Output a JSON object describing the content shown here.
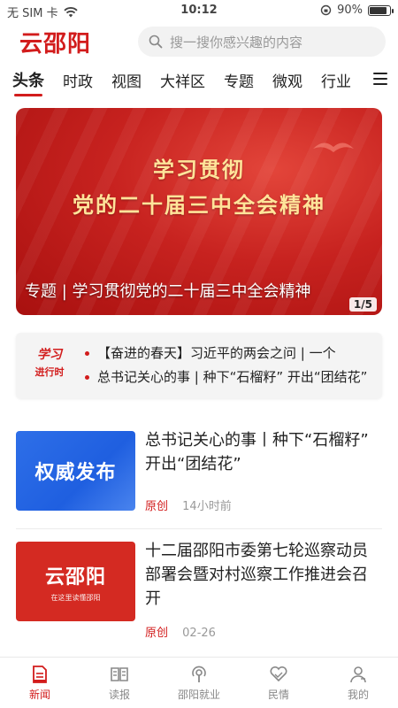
{
  "status_bar": {
    "carrier": "无 SIM 卡",
    "time": "10:12",
    "battery": "90%",
    "battery_level": 0.9
  },
  "header": {
    "logo": "云邵阳",
    "search_placeholder": "搜一搜你感兴趣的内容"
  },
  "tabs": [
    {
      "label": "头条",
      "active": true
    },
    {
      "label": "时政"
    },
    {
      "label": "视图"
    },
    {
      "label": "大祥区"
    },
    {
      "label": "专题"
    },
    {
      "label": "微观"
    },
    {
      "label": "行业"
    }
  ],
  "banner": {
    "title_line1": "学习贯彻",
    "title_line2": "党的二十届三中全会精神",
    "caption": "专题 | 学习贯彻党的二十届三中全会精神",
    "counter": "1/5"
  },
  "study_box": {
    "badge_line1": "学习",
    "badge_line2": "进行时",
    "items": [
      "【奋进的春天】习近平的两会之问 | 一个",
      "总书记关心的事 | 种下“石榴籽” 开出“团结花”"
    ]
  },
  "news": [
    {
      "thumb_text": "权威发布",
      "title": "总书记关心的事丨种下“石榴籽” 开出“团结花”",
      "tag": "原创",
      "time": "14小时前"
    },
    {
      "thumb_text": "云邵阳",
      "thumb_sub": "在这里读懂邵阳",
      "title": "十二届邵阳市委第七轮巡察动员部署会暨对村巡察工作推进会召开",
      "tag": "原创",
      "time": "02-26"
    }
  ],
  "bottom_nav": [
    {
      "label": "新闻",
      "icon": "news-icon",
      "active": true
    },
    {
      "label": "读报",
      "icon": "newspaper-icon"
    },
    {
      "label": "邵阳就业",
      "icon": "podcast-icon"
    },
    {
      "label": "民情",
      "icon": "heart-hands-icon"
    },
    {
      "label": "我的",
      "icon": "user-icon"
    }
  ],
  "colors": {
    "accent": "#d21c1c",
    "blue_thumb": "#2e6fe8"
  }
}
